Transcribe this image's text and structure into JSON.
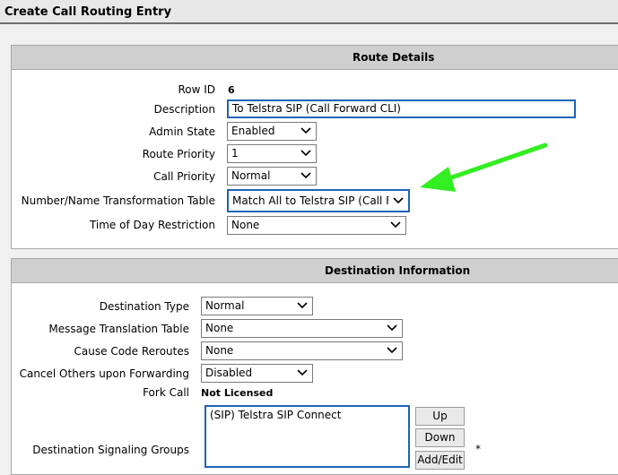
{
  "window": {
    "title": "Create Call Routing Entry"
  },
  "route_details": {
    "header": "Route Details",
    "row_id": {
      "label": "Row ID",
      "value": "6"
    },
    "description": {
      "label": "Description",
      "value": "To Telstra SIP (Call Forward CLI)"
    },
    "admin_state": {
      "label": "Admin State",
      "value": "Enabled"
    },
    "route_priority": {
      "label": "Route Priority",
      "value": "1"
    },
    "call_priority": {
      "label": "Call Priority",
      "value": "Normal"
    },
    "transformation_table": {
      "label": "Number/Name Transformation Table",
      "value": "Match All to Telstra SIP (Call Forw"
    },
    "time_of_day": {
      "label": "Time of Day Restriction",
      "value": "None"
    }
  },
  "destination": {
    "header": "Destination Information",
    "destination_type": {
      "label": "Destination Type",
      "value": "Normal"
    },
    "message_translation": {
      "label": "Message Translation Table",
      "value": "None"
    },
    "cause_code_reroutes": {
      "label": "Cause Code Reroutes",
      "value": "None"
    },
    "cancel_others": {
      "label": "Cancel Others upon Forwarding",
      "value": "Disabled"
    },
    "fork_call": {
      "label": "Fork Call",
      "value": "Not Licensed"
    },
    "signaling_groups": {
      "label": "Destination Signaling Groups",
      "items": [
        "(SIP) Telstra SIP Connect"
      ],
      "up_label": "Up",
      "down_label": "Down",
      "add_edit_label": "Add/Edit",
      "required_mark": "*"
    }
  },
  "colors": {
    "highlight_border": "#1e64b4",
    "annotation_arrow": "#33ee22",
    "panel_header": "#cfcfcf"
  }
}
